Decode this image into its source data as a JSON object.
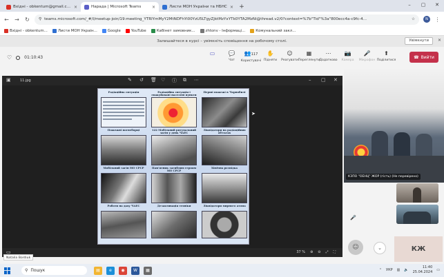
{
  "tabs": [
    {
      "title": "Вхідні - obkentum@gmail.com"
    },
    {
      "title": "Нарада | Microsoft Teams"
    },
    {
      "title": "Листи МОН України та НБНС"
    }
  ],
  "address": {
    "url": "teams.microsoft.com/_#/l/meetup-join/19:meeting_YTRlYmMyY2MtNDFhYi00YzU5LTgyZjktMzYxYTk0YTA2MzNi@thread.v2/0?context=%7b\"Tid\"%3a\"800ecc4a-c9fc-4..."
  },
  "profile": {
    "letter": "N"
  },
  "bookmarks": [
    {
      "label": "Вхідні - obkentum..."
    },
    {
      "label": "Листи МОН Украін..."
    },
    {
      "label": "Google"
    },
    {
      "label": "YouTube"
    },
    {
      "label": "Кабінет замовник..."
    },
    {
      "label": "zhtonv - Інформаці..."
    },
    {
      "label": "Комунальний закл..."
    }
  ],
  "notification": {
    "text": "Залишайтеся в курсі – увімкніть сповіщення на робочому столі.",
    "button": "Увімкнути"
  },
  "meeting": {
    "timer": "01:10:43"
  },
  "tools": [
    {
      "label": "Чат",
      "icon": "💬"
    },
    {
      "label": "Користувачі",
      "icon": "👥",
      "badge": "117"
    },
    {
      "label": "Підняти",
      "icon": "✋"
    },
    {
      "label": "Реагувати",
      "icon": "☺"
    },
    {
      "label": "Переглянути",
      "icon": "▦"
    },
    {
      "label": "Додатково",
      "icon": "⋯"
    },
    {
      "label": "Камера",
      "icon": "📷"
    },
    {
      "label": "Мікрофон",
      "icon": "🎤"
    },
    {
      "label": "Поділитися",
      "icon": "⬆"
    }
  ],
  "leave_label": "Вийти",
  "viewer": {
    "filename": "11.jpg",
    "zoom": "37 %"
  },
  "poster": {
    "cells": [
      {
        "caption": "Радіаційна ситуація"
      },
      {
        "caption": "Радіаційна ситуація і евакуйовані населені пункти"
      },
      {
        "caption": "Перші пожежі в Чорнобилі"
      },
      {
        "caption": "Пожежні вогнеборці"
      },
      {
        "caption": "122 Мобільний рятувальний загін у день ЧАЕС"
      },
      {
        "caption": "Ліквідатори на радіаційних об'єктах"
      },
      {
        "caption": "Мобільний загін МО СРСР"
      },
      {
        "caption": "Пам'ятник загиблим героям МО СРСР"
      },
      {
        "caption": "Хімічна розвідка"
      },
      {
        "caption": "Роботи на даху ЧАЕС"
      },
      {
        "caption": "Дезактивація техніки"
      },
      {
        "caption": "Ліквідатори мирного атома"
      }
    ]
  },
  "video_label": "КЗПО \"ОЕНЦ\" ЖОР (гість) (Не перевірено)",
  "presenter_name": "Natalia Bordiuk",
  "initials": "КЖ",
  "taskbar": {
    "search": "Пошук",
    "lang": "УКР",
    "time": "11:40",
    "date": "25.04.2024"
  }
}
